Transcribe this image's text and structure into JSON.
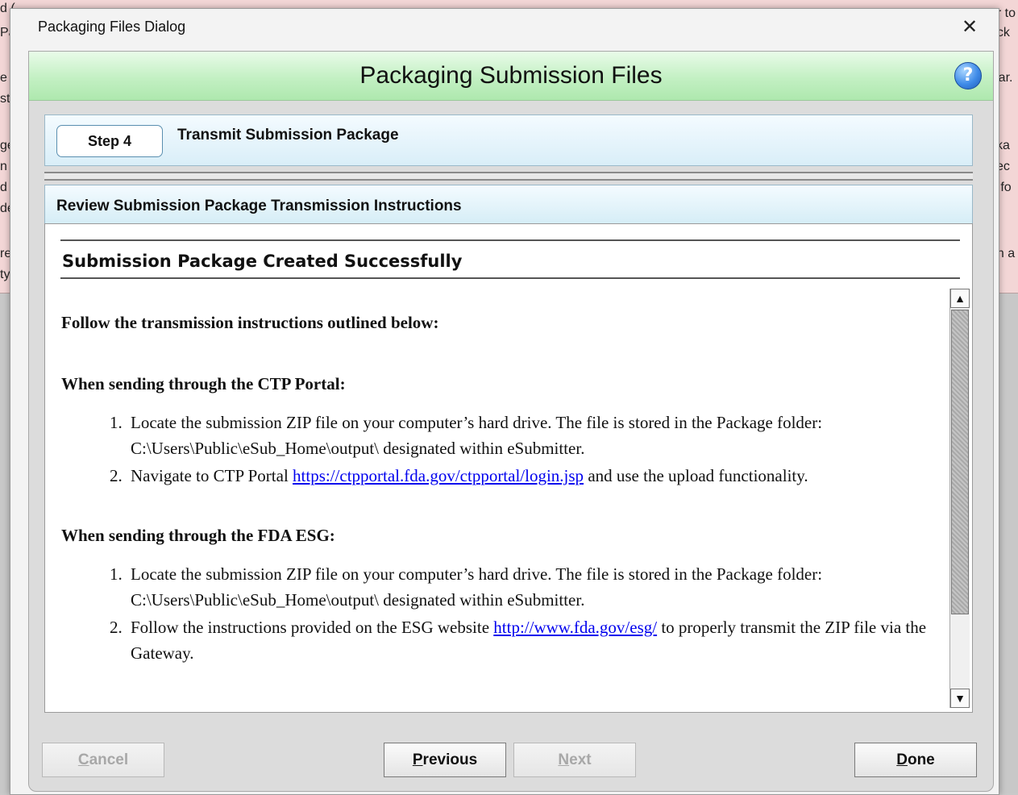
{
  "background": {
    "fragments": [
      "d (",
      "Pa",
      "e a",
      "sti",
      "ge",
      "n fi",
      "d a",
      "de",
      "re",
      "typ",
      "er to",
      "ack",
      "Bar.",
      "cka",
      "yec",
      "e fo",
      "on a"
    ]
  },
  "dialog": {
    "title": "Packaging Files Dialog",
    "close_glyph": "✕",
    "header": "Packaging Submission Files",
    "help_glyph": "?"
  },
  "step": {
    "badge": "Step 4",
    "label": "Transmit Submission Package"
  },
  "review": {
    "label": "Review Submission Package Transmission Instructions"
  },
  "content": {
    "success_title": "Submission Package Created Successfully",
    "intro": "Follow the transmission instructions outlined below:",
    "ctp": {
      "heading": "When sending through the CTP Portal:",
      "item1_num": "1.",
      "item1": "Locate the submission ZIP file on your computer’s hard drive. The file is stored in the Package folder: C:\\Users\\Public\\eSub_Home\\output\\ designated within eSubmitter.",
      "item2_num": "2.",
      "item2_pre": "Navigate to CTP Portal ",
      "item2_link": "https://ctpportal.fda.gov/ctpportal/login.jsp",
      "item2_post": " and use the upload functionality."
    },
    "esg": {
      "heading": "When sending through the FDA ESG:",
      "item1_num": "1.",
      "item1": "Locate the submission ZIP file on your computer’s hard drive. The file is stored in the Package folder: C:\\Users\\Public\\eSub_Home\\output\\ designated within eSubmitter.",
      "item2_num": "2.",
      "item2_pre": "Follow the instructions provided on the ESG website ",
      "item2_link": "http://www.fda.gov/esg/",
      "item2_post": " to properly transmit the ZIP file via the Gateway."
    }
  },
  "scrollbar": {
    "up_glyph": "▲",
    "down_glyph": "▼"
  },
  "buttons": {
    "cancel_first": "C",
    "cancel_rest": "ancel",
    "previous_first": "P",
    "previous_rest": "revious",
    "next_first": "N",
    "next_rest": "ext",
    "done_first": "D",
    "done_rest": "one"
  }
}
